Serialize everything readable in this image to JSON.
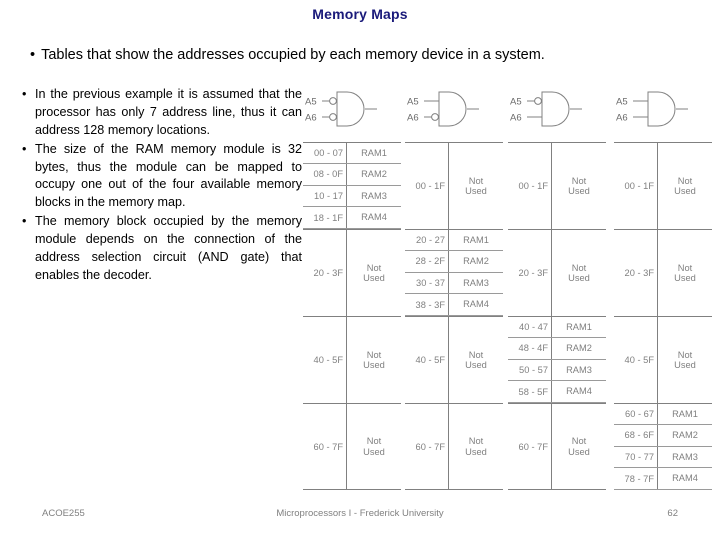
{
  "slide": {
    "title": "Memory Maps",
    "lead_bullet": "Tables that show the addresses occupied by each memory device in a system.",
    "bullet_marker": "•"
  },
  "body_bullets": [
    "In the previous example it is assumed that the processor has only 7 address line, thus it can address 128 memory locations.",
    "The size of the RAM memory module is 32 bytes, thus the module can be mapped to occupy one out of the four available memory blocks in the memory map.",
    "The memory block occupied by the memory module depends on the connection of the address selection circuit (AND gate) that enables the decoder."
  ],
  "maps": [
    {
      "gate": {
        "input_labels": [
          "A5",
          "A6"
        ],
        "inverted": [
          true,
          true
        ],
        "type": "and-gate"
      },
      "blocks": [
        {
          "range": "00 - 1F",
          "expanded": true,
          "rows": [
            {
              "range": "00 - 07",
              "name": "RAM1"
            },
            {
              "range": "08 - 0F",
              "name": "RAM2"
            },
            {
              "range": "10 - 17",
              "name": "RAM3"
            },
            {
              "range": "18 - 1F",
              "name": "RAM4"
            }
          ]
        },
        {
          "range": "20 - 3F",
          "expanded": false,
          "name": "Not Used"
        },
        {
          "range": "40 - 5F",
          "expanded": false,
          "name": "Not Used"
        },
        {
          "range": "60 - 7F",
          "expanded": false,
          "name": "Not Used"
        }
      ]
    },
    {
      "gate": {
        "input_labels": [
          "A5",
          "A6"
        ],
        "inverted": [
          false,
          true
        ],
        "type": "and-gate"
      },
      "blocks": [
        {
          "range": "00 - 1F",
          "expanded": false,
          "name": "Not Used"
        },
        {
          "range": "20 - 3F",
          "expanded": true,
          "rows": [
            {
              "range": "20 - 27",
              "name": "RAM1"
            },
            {
              "range": "28 - 2F",
              "name": "RAM2"
            },
            {
              "range": "30 - 37",
              "name": "RAM3"
            },
            {
              "range": "38 - 3F",
              "name": "RAM4"
            }
          ]
        },
        {
          "range": "40 - 5F",
          "expanded": false,
          "name": "Not Used"
        },
        {
          "range": "60 - 7F",
          "expanded": false,
          "name": "Not Used"
        }
      ]
    },
    {
      "gate": {
        "input_labels": [
          "A5",
          "A6"
        ],
        "inverted": [
          true,
          false
        ],
        "type": "and-gate"
      },
      "blocks": [
        {
          "range": "00 - 1F",
          "expanded": false,
          "name": "Not Used"
        },
        {
          "range": "20 - 3F",
          "expanded": false,
          "name": "Not Used"
        },
        {
          "range": "40 - 5F",
          "expanded": true,
          "rows": [
            {
              "range": "40 - 47",
              "name": "RAM1"
            },
            {
              "range": "48 - 4F",
              "name": "RAM2"
            },
            {
              "range": "50 - 57",
              "name": "RAM3"
            },
            {
              "range": "58 - 5F",
              "name": "RAM4"
            }
          ]
        },
        {
          "range": "60 - 7F",
          "expanded": false,
          "name": "Not Used"
        }
      ]
    },
    {
      "gate": {
        "input_labels": [
          "A5",
          "A6"
        ],
        "inverted": [
          false,
          false
        ],
        "type": "and-gate"
      },
      "blocks": [
        {
          "range": "00 - 1F",
          "expanded": false,
          "name": "Not Used"
        },
        {
          "range": "20 - 3F",
          "expanded": false,
          "name": "Not Used"
        },
        {
          "range": "40 - 5F",
          "expanded": false,
          "name": "Not Used"
        },
        {
          "range": "60 - 7F",
          "expanded": true,
          "rows": [
            {
              "range": "60 - 67",
              "name": "RAM1"
            },
            {
              "range": "68 - 6F",
              "name": "RAM2"
            },
            {
              "range": "70 - 77",
              "name": "RAM3"
            },
            {
              "range": "78 - 7F",
              "name": "RAM4"
            }
          ]
        }
      ]
    }
  ],
  "footer": {
    "course": "ACOE255",
    "center": "Microprocessors I - Frederick University",
    "page": "62"
  },
  "colors": {
    "title": "#1a1a7a",
    "body": "#000000",
    "diagram": "#808080",
    "footer": "#808080"
  }
}
